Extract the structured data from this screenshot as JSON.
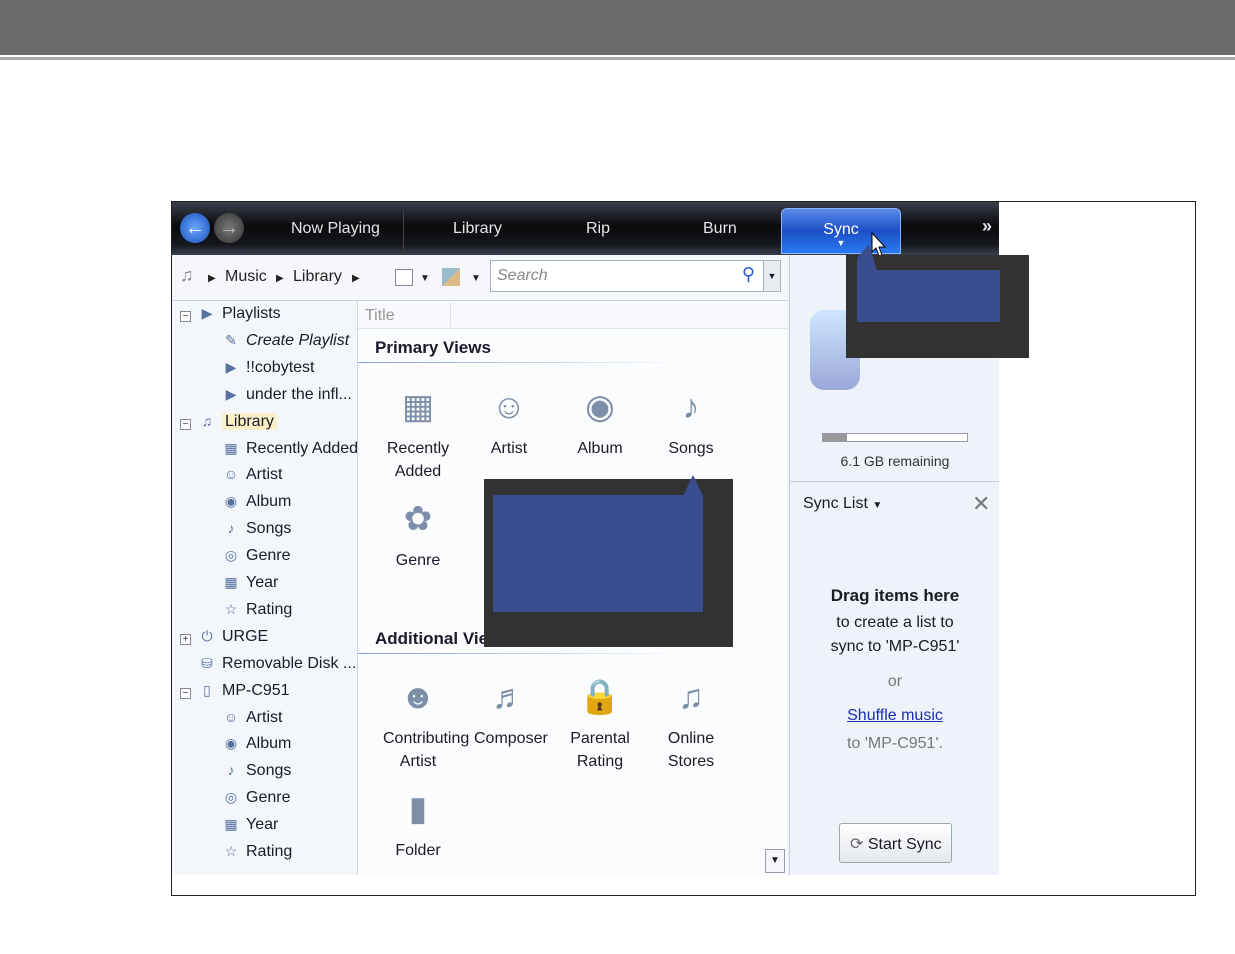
{
  "nav": {
    "tabs": [
      "Now Playing",
      "Library",
      "Rip",
      "Burn",
      "Sync"
    ],
    "active": "Sync",
    "more": "»"
  },
  "address": {
    "crumbs": [
      "Music",
      "Library"
    ],
    "search_placeholder": "Search"
  },
  "tree": [
    {
      "label": "Playlists",
      "icon": "playlist-icon",
      "level": 0,
      "expander": "⊟"
    },
    {
      "label": "Create Playlist",
      "icon": "create-playlist-icon",
      "level": 1,
      "italic": true
    },
    {
      "label": "!!cobytest",
      "icon": "playlist-icon",
      "level": 1
    },
    {
      "label": "under the infl...",
      "icon": "playlist-icon",
      "level": 1
    },
    {
      "label": "Library",
      "icon": "music-note-icon",
      "level": 0,
      "expander": "⊟",
      "selected": true
    },
    {
      "label": "Recently Added",
      "icon": "recently-added-icon",
      "level": 1
    },
    {
      "label": "Artist",
      "icon": "artist-icon",
      "level": 1
    },
    {
      "label": "Album",
      "icon": "album-icon",
      "level": 1
    },
    {
      "label": "Songs",
      "icon": "song-icon",
      "level": 1
    },
    {
      "label": "Genre",
      "icon": "genre-icon",
      "level": 1
    },
    {
      "label": "Year",
      "icon": "year-icon",
      "level": 1
    },
    {
      "label": "Rating",
      "icon": "rating-icon",
      "level": 1
    },
    {
      "label": "URGE",
      "icon": "urge-icon",
      "level": 0,
      "expander": "⊞"
    },
    {
      "label": "Removable Disk ...",
      "icon": "removable-disk-icon",
      "level": 0
    },
    {
      "label": "MP-C951",
      "icon": "device-icon",
      "level": 0,
      "expander": "⊟"
    },
    {
      "label": "Artist",
      "icon": "artist-icon",
      "level": 1
    },
    {
      "label": "Album",
      "icon": "album-icon",
      "level": 1
    },
    {
      "label": "Songs",
      "icon": "song-icon",
      "level": 1
    },
    {
      "label": "Genre",
      "icon": "genre-icon",
      "level": 1
    },
    {
      "label": "Year",
      "icon": "year-icon",
      "level": 1
    },
    {
      "label": "Rating",
      "icon": "rating-icon",
      "level": 1
    }
  ],
  "content": {
    "column_header": "Title",
    "primary_title": "Primary Views",
    "primary": [
      {
        "label": "Recently Added",
        "icon": "calendar-icon"
      },
      {
        "label": "Artist",
        "icon": "artist-icon"
      },
      {
        "label": "Album",
        "icon": "album-icon"
      },
      {
        "label": "Songs",
        "icon": "song-icon"
      },
      {
        "label": "Genre",
        "icon": "genre-icon"
      }
    ],
    "additional_title": "Additional Vie",
    "additional": [
      {
        "label": "Contributing Artist",
        "icon": "contributing-artist-icon"
      },
      {
        "label": "Composer",
        "icon": "composer-icon"
      },
      {
        "label": "Parental Rating",
        "icon": "lock-icon"
      },
      {
        "label": "Online Stores",
        "icon": "online-stores-icon"
      },
      {
        "label": "Folder",
        "icon": "folder-icon"
      }
    ]
  },
  "sync": {
    "storage_used_percent": 17,
    "remaining": "6.1 GB remaining",
    "list_label": "Sync List",
    "drag_title": "Drag items here",
    "drag_line1": "to create a list to",
    "drag_line2": "sync to 'MP-C951'",
    "or": "or",
    "shuffle_link": "Shuffle music",
    "shuffle_to": "to 'MP-C951'.",
    "start_sync": "Start Sync"
  },
  "colors": {
    "callout_dark": "#333233",
    "callout_blue": "#394d8f",
    "sync_tab": "#1d4fc8"
  }
}
